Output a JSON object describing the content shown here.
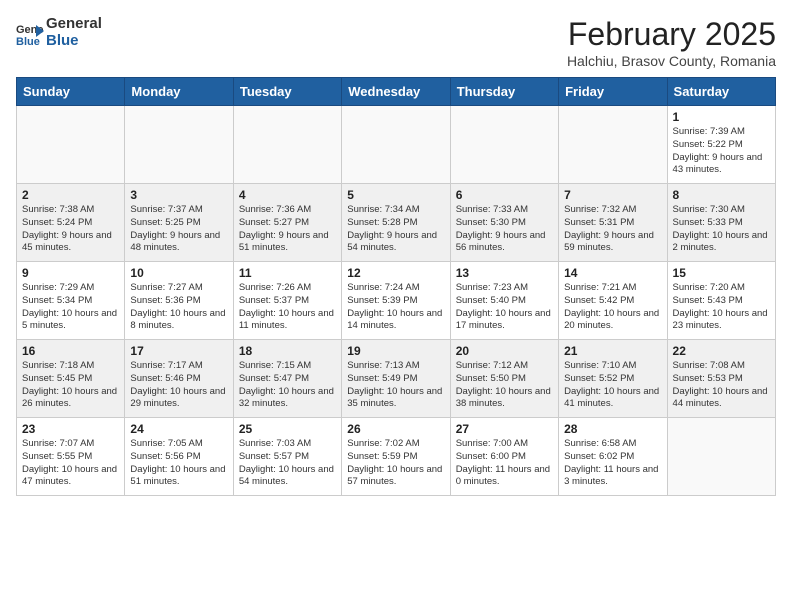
{
  "header": {
    "logo_line1": "General",
    "logo_line2": "Blue",
    "month_title": "February 2025",
    "location": "Halchiu, Brasov County, Romania"
  },
  "weekdays": [
    "Sunday",
    "Monday",
    "Tuesday",
    "Wednesday",
    "Thursday",
    "Friday",
    "Saturday"
  ],
  "weeks": [
    [
      {
        "day": "",
        "info": ""
      },
      {
        "day": "",
        "info": ""
      },
      {
        "day": "",
        "info": ""
      },
      {
        "day": "",
        "info": ""
      },
      {
        "day": "",
        "info": ""
      },
      {
        "day": "",
        "info": ""
      },
      {
        "day": "1",
        "info": "Sunrise: 7:39 AM\nSunset: 5:22 PM\nDaylight: 9 hours and 43 minutes."
      }
    ],
    [
      {
        "day": "2",
        "info": "Sunrise: 7:38 AM\nSunset: 5:24 PM\nDaylight: 9 hours and 45 minutes."
      },
      {
        "day": "3",
        "info": "Sunrise: 7:37 AM\nSunset: 5:25 PM\nDaylight: 9 hours and 48 minutes."
      },
      {
        "day": "4",
        "info": "Sunrise: 7:36 AM\nSunset: 5:27 PM\nDaylight: 9 hours and 51 minutes."
      },
      {
        "day": "5",
        "info": "Sunrise: 7:34 AM\nSunset: 5:28 PM\nDaylight: 9 hours and 54 minutes."
      },
      {
        "day": "6",
        "info": "Sunrise: 7:33 AM\nSunset: 5:30 PM\nDaylight: 9 hours and 56 minutes."
      },
      {
        "day": "7",
        "info": "Sunrise: 7:32 AM\nSunset: 5:31 PM\nDaylight: 9 hours and 59 minutes."
      },
      {
        "day": "8",
        "info": "Sunrise: 7:30 AM\nSunset: 5:33 PM\nDaylight: 10 hours and 2 minutes."
      }
    ],
    [
      {
        "day": "9",
        "info": "Sunrise: 7:29 AM\nSunset: 5:34 PM\nDaylight: 10 hours and 5 minutes."
      },
      {
        "day": "10",
        "info": "Sunrise: 7:27 AM\nSunset: 5:36 PM\nDaylight: 10 hours and 8 minutes."
      },
      {
        "day": "11",
        "info": "Sunrise: 7:26 AM\nSunset: 5:37 PM\nDaylight: 10 hours and 11 minutes."
      },
      {
        "day": "12",
        "info": "Sunrise: 7:24 AM\nSunset: 5:39 PM\nDaylight: 10 hours and 14 minutes."
      },
      {
        "day": "13",
        "info": "Sunrise: 7:23 AM\nSunset: 5:40 PM\nDaylight: 10 hours and 17 minutes."
      },
      {
        "day": "14",
        "info": "Sunrise: 7:21 AM\nSunset: 5:42 PM\nDaylight: 10 hours and 20 minutes."
      },
      {
        "day": "15",
        "info": "Sunrise: 7:20 AM\nSunset: 5:43 PM\nDaylight: 10 hours and 23 minutes."
      }
    ],
    [
      {
        "day": "16",
        "info": "Sunrise: 7:18 AM\nSunset: 5:45 PM\nDaylight: 10 hours and 26 minutes."
      },
      {
        "day": "17",
        "info": "Sunrise: 7:17 AM\nSunset: 5:46 PM\nDaylight: 10 hours and 29 minutes."
      },
      {
        "day": "18",
        "info": "Sunrise: 7:15 AM\nSunset: 5:47 PM\nDaylight: 10 hours and 32 minutes."
      },
      {
        "day": "19",
        "info": "Sunrise: 7:13 AM\nSunset: 5:49 PM\nDaylight: 10 hours and 35 minutes."
      },
      {
        "day": "20",
        "info": "Sunrise: 7:12 AM\nSunset: 5:50 PM\nDaylight: 10 hours and 38 minutes."
      },
      {
        "day": "21",
        "info": "Sunrise: 7:10 AM\nSunset: 5:52 PM\nDaylight: 10 hours and 41 minutes."
      },
      {
        "day": "22",
        "info": "Sunrise: 7:08 AM\nSunset: 5:53 PM\nDaylight: 10 hours and 44 minutes."
      }
    ],
    [
      {
        "day": "23",
        "info": "Sunrise: 7:07 AM\nSunset: 5:55 PM\nDaylight: 10 hours and 47 minutes."
      },
      {
        "day": "24",
        "info": "Sunrise: 7:05 AM\nSunset: 5:56 PM\nDaylight: 10 hours and 51 minutes."
      },
      {
        "day": "25",
        "info": "Sunrise: 7:03 AM\nSunset: 5:57 PM\nDaylight: 10 hours and 54 minutes."
      },
      {
        "day": "26",
        "info": "Sunrise: 7:02 AM\nSunset: 5:59 PM\nDaylight: 10 hours and 57 minutes."
      },
      {
        "day": "27",
        "info": "Sunrise: 7:00 AM\nSunset: 6:00 PM\nDaylight: 11 hours and 0 minutes."
      },
      {
        "day": "28",
        "info": "Sunrise: 6:58 AM\nSunset: 6:02 PM\nDaylight: 11 hours and 3 minutes."
      },
      {
        "day": "",
        "info": ""
      }
    ]
  ]
}
